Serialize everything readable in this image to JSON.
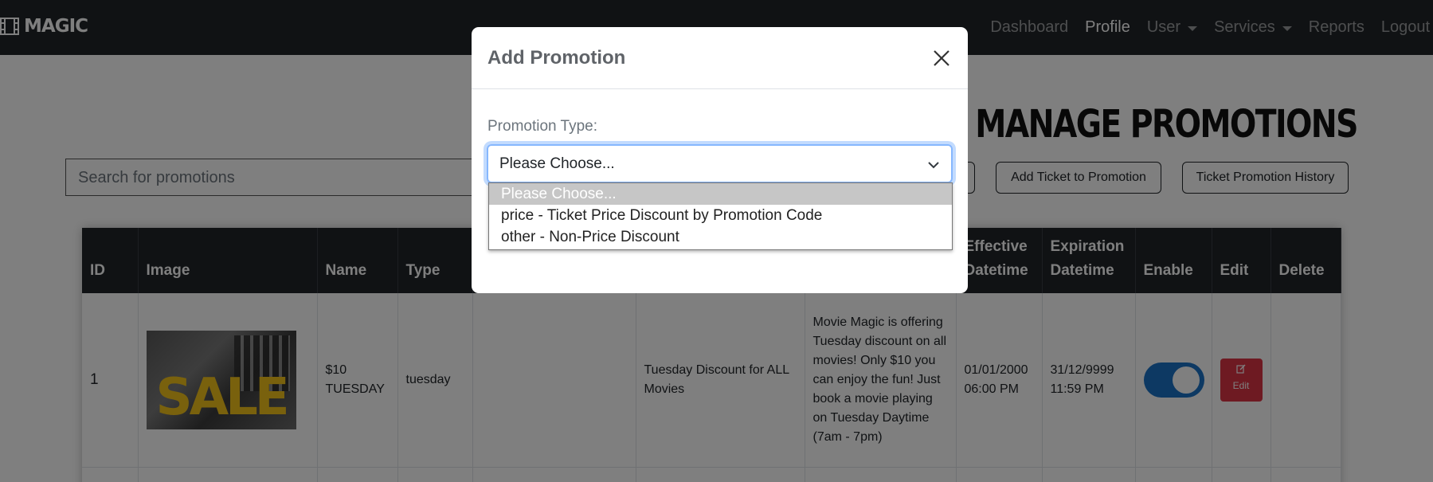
{
  "navbar": {
    "brand": "MAGIC",
    "items": [
      {
        "label": "Dashboard",
        "active": false,
        "dropdown": false
      },
      {
        "label": "Profile",
        "active": true,
        "dropdown": false
      },
      {
        "label": "User",
        "active": false,
        "dropdown": true
      },
      {
        "label": "Services",
        "active": false,
        "dropdown": true
      },
      {
        "label": "Reports",
        "active": false,
        "dropdown": false
      },
      {
        "label": "Logout",
        "active": false,
        "dropdown": false
      }
    ]
  },
  "page": {
    "title": "MANAGE PROMOTIONS",
    "search_placeholder": "Search for promotions",
    "buttons": {
      "add_ticket": "Add Ticket to Promotion",
      "history": "Ticket Promotion History"
    }
  },
  "table": {
    "columns": [
      "ID",
      "Image",
      "Name",
      "Type",
      "",
      "",
      "",
      "Effective Datetime",
      "Expiration Datetime",
      "Enable",
      "Edit",
      "Delete"
    ],
    "rows": [
      {
        "id": "1",
        "image_text": "SALE",
        "name": "$10 TUESDAY",
        "type": "tuesday",
        "col5": "",
        "col6": "Tuesday Discount for ALL Movies",
        "description": "Movie Magic is offering Tuesday discount on all movies! Only $10 you can enjoy the fun! Just book a movie playing on Tuesday Daytime (7am - 7pm)",
        "effective": "01/01/2000 06:00 PM",
        "expiration": "31/12/9999 11:59 PM",
        "enabled": true,
        "edit_label": "Edit"
      }
    ]
  },
  "modal": {
    "title": "Add Promotion",
    "promotion_type_label": "Promotion Type:",
    "select_value": "Please Choose...",
    "options": [
      "Please Choose...",
      "price - Ticket Price Discount by Promotion Code",
      "other - Non-Price Discount"
    ]
  },
  "colors": {
    "navbar_bg": "#212529",
    "danger": "#dc3545",
    "toggle_on": "#1b73c7",
    "focus_ring": "#86b7fe"
  }
}
